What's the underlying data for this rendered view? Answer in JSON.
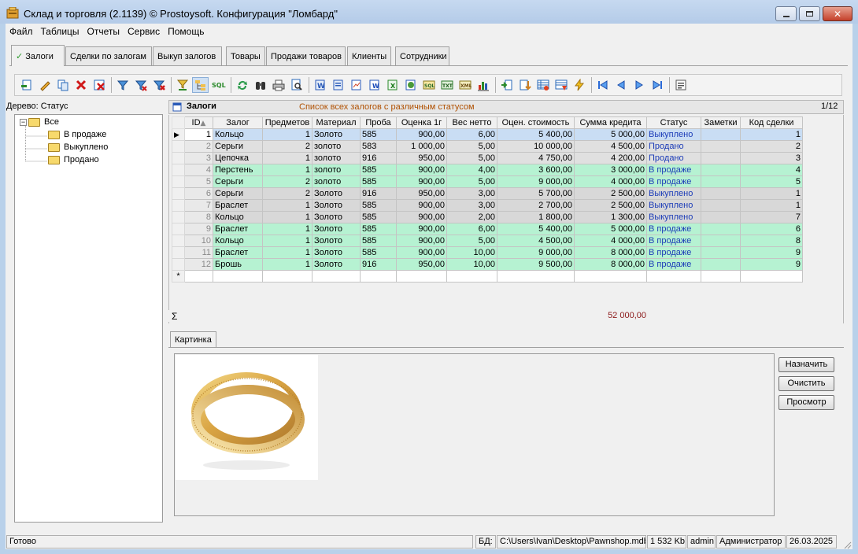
{
  "window": {
    "title": "Склад и торговля (2.1139) © Prostoysoft. Конфигурация \"Ломбард\""
  },
  "menu": [
    "Файл",
    "Таблицы",
    "Отчеты",
    "Сервис",
    "Помощь"
  ],
  "tabs": [
    "Залоги",
    "Сделки по залогам",
    "Выкуп залогов",
    "Товары",
    "Продажи товаров",
    "Клиенты",
    "Сотрудники"
  ],
  "tree": {
    "label": "Дерево: Статус",
    "root": "Все",
    "children": [
      "В продаже",
      "Выкуплено",
      "Продано"
    ]
  },
  "grid": {
    "title": "Залоги",
    "subtitle": "Список всех залогов с различным статусом",
    "position": "1/12",
    "columns": [
      "ID",
      "Залог",
      "Предметов",
      "Материал",
      "Проба",
      "Оценка 1г",
      "Вес нетто",
      "Оцен. стоимость",
      "Сумма кредита",
      "Статус",
      "Заметки",
      "Код сделки"
    ],
    "rows": [
      {
        "id": "1",
        "item": "Кольцо",
        "qty": "1",
        "mat": "Золото",
        "probe": "585",
        "price": "900,00",
        "weight": "6,00",
        "value": "5 400,00",
        "credit": "5 000,00",
        "status": "Выкуплено",
        "notes": "",
        "deal": "1"
      },
      {
        "id": "2",
        "item": "Серьги",
        "qty": "2",
        "mat": "золото",
        "probe": "583",
        "price": "1 000,00",
        "weight": "5,00",
        "value": "10 000,00",
        "credit": "4 500,00",
        "status": "Продано",
        "notes": "",
        "deal": "2"
      },
      {
        "id": "3",
        "item": "Цепочка",
        "qty": "1",
        "mat": "золото",
        "probe": "916",
        "price": "950,00",
        "weight": "5,00",
        "value": "4 750,00",
        "credit": "4 200,00",
        "status": "Продано",
        "notes": "",
        "deal": "3"
      },
      {
        "id": "4",
        "item": "Перстень",
        "qty": "1",
        "mat": "золото",
        "probe": "585",
        "price": "900,00",
        "weight": "4,00",
        "value": "3 600,00",
        "credit": "3 000,00",
        "status": "В продаже",
        "notes": "",
        "deal": "4"
      },
      {
        "id": "5",
        "item": "Серьги",
        "qty": "2",
        "mat": "золото",
        "probe": "585",
        "price": "900,00",
        "weight": "5,00",
        "value": "9 000,00",
        "credit": "4 000,00",
        "status": "В продаже",
        "notes": "",
        "deal": "5"
      },
      {
        "id": "6",
        "item": "Серьги",
        "qty": "2",
        "mat": "Золото",
        "probe": "916",
        "price": "950,00",
        "weight": "3,00",
        "value": "5 700,00",
        "credit": "2 500,00",
        "status": "Выкуплено",
        "notes": "",
        "deal": "1"
      },
      {
        "id": "7",
        "item": "Браслет",
        "qty": "1",
        "mat": "Золото",
        "probe": "585",
        "price": "900,00",
        "weight": "3,00",
        "value": "2 700,00",
        "credit": "2 500,00",
        "status": "Выкуплено",
        "notes": "",
        "deal": "1"
      },
      {
        "id": "8",
        "item": "Кольцо",
        "qty": "1",
        "mat": "Золото",
        "probe": "585",
        "price": "900,00",
        "weight": "2,00",
        "value": "1 800,00",
        "credit": "1 300,00",
        "status": "Выкуплено",
        "notes": "",
        "deal": "7"
      },
      {
        "id": "9",
        "item": "Браслет",
        "qty": "1",
        "mat": "Золото",
        "probe": "585",
        "price": "900,00",
        "weight": "6,00",
        "value": "5 400,00",
        "credit": "5 000,00",
        "status": "В продаже",
        "notes": "",
        "deal": "6"
      },
      {
        "id": "10",
        "item": "Кольцо",
        "qty": "1",
        "mat": "Золото",
        "probe": "585",
        "price": "900,00",
        "weight": "5,00",
        "value": "4 500,00",
        "credit": "4 000,00",
        "status": "В продаже",
        "notes": "",
        "deal": "8"
      },
      {
        "id": "11",
        "item": "Браслет",
        "qty": "1",
        "mat": "Золото",
        "probe": "585",
        "price": "900,00",
        "weight": "10,00",
        "value": "9 000,00",
        "credit": "8 000,00",
        "status": "В продаже",
        "notes": "",
        "deal": "9"
      },
      {
        "id": "12",
        "item": "Брошь",
        "qty": "1",
        "mat": "Золото",
        "probe": "916",
        "price": "950,00",
        "weight": "10,00",
        "value": "9 500,00",
        "credit": "8 000,00",
        "status": "В продаже",
        "notes": "",
        "deal": "9"
      }
    ],
    "new_row_marker": "*",
    "sum_symbol": "Σ",
    "sum_credit": "52 000,00"
  },
  "picture": {
    "tab": "Картинка",
    "buttons": [
      "Назначить",
      "Очистить",
      "Просмотр"
    ]
  },
  "status": {
    "ready": "Готово",
    "db_label": "БД:",
    "db_path": "C:\\Users\\Ivan\\Desktop\\Pawnshop.mdb",
    "size": "1 532 Kb",
    "user": "admin",
    "role": "Администратор",
    "date": "26.03.2025"
  },
  "colors": {
    "row_green": "#b6f2d2",
    "row_gray": "#d8d8d8",
    "row_selected": "#c9ddf4",
    "status_text": "#1c3cb8",
    "sum": "#8c1a1a"
  }
}
